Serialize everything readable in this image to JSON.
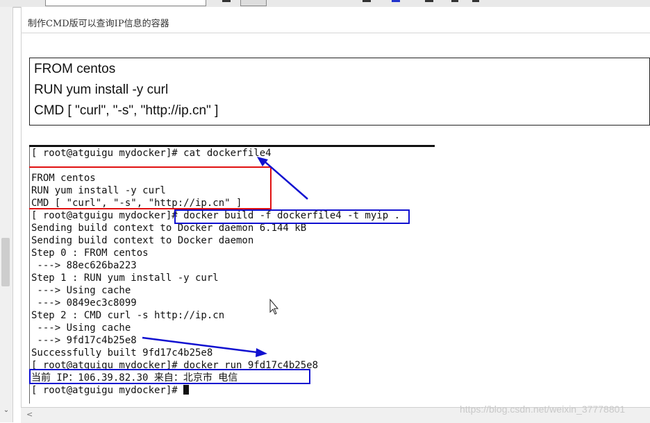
{
  "page": {
    "title": "制作CMD版可以查询IP信息的容器"
  },
  "dockerfile": {
    "lines": [
      "FROM centos",
      "RUN yum install -y curl",
      "CMD [ \"curl\", \"-s\", \"http://ip.cn\" ]"
    ]
  },
  "terminal": {
    "lines": [
      "[ root@atguigu mydocker]# cat dockerfile4",
      "",
      "FROM centos",
      "RUN yum install -y curl",
      "CMD [ \"curl\", \"-s\", \"http://ip.cn\" ]",
      "[ root@atguigu mydocker]# docker build -f dockerfile4 -t myip .",
      "Sending build context to Docker daemon 6.144 kB",
      "Sending build context to Docker daemon",
      "Step 0 : FROM centos",
      " ---> 88ec626ba223",
      "Step 1 : RUN yum install -y curl",
      " ---> Using cache",
      " ---> 0849ec3c8099",
      "Step 2 : CMD curl -s http://ip.cn",
      " ---> Using cache",
      " ---> 9fd17c4b25e8",
      "Successfully built 9fd17c4b25e8",
      "[ root@atguigu mydocker]# docker run 9fd17c4b25e8",
      "当前 IP：106.39.82.30 来自：北京市 电信",
      "[ root@atguigu mydocker]# "
    ]
  },
  "watermark": "https://blog.csdn.net/weixin_37778801",
  "colors": {
    "annotation_red": "#e01010",
    "annotation_blue": "#1010d0"
  }
}
